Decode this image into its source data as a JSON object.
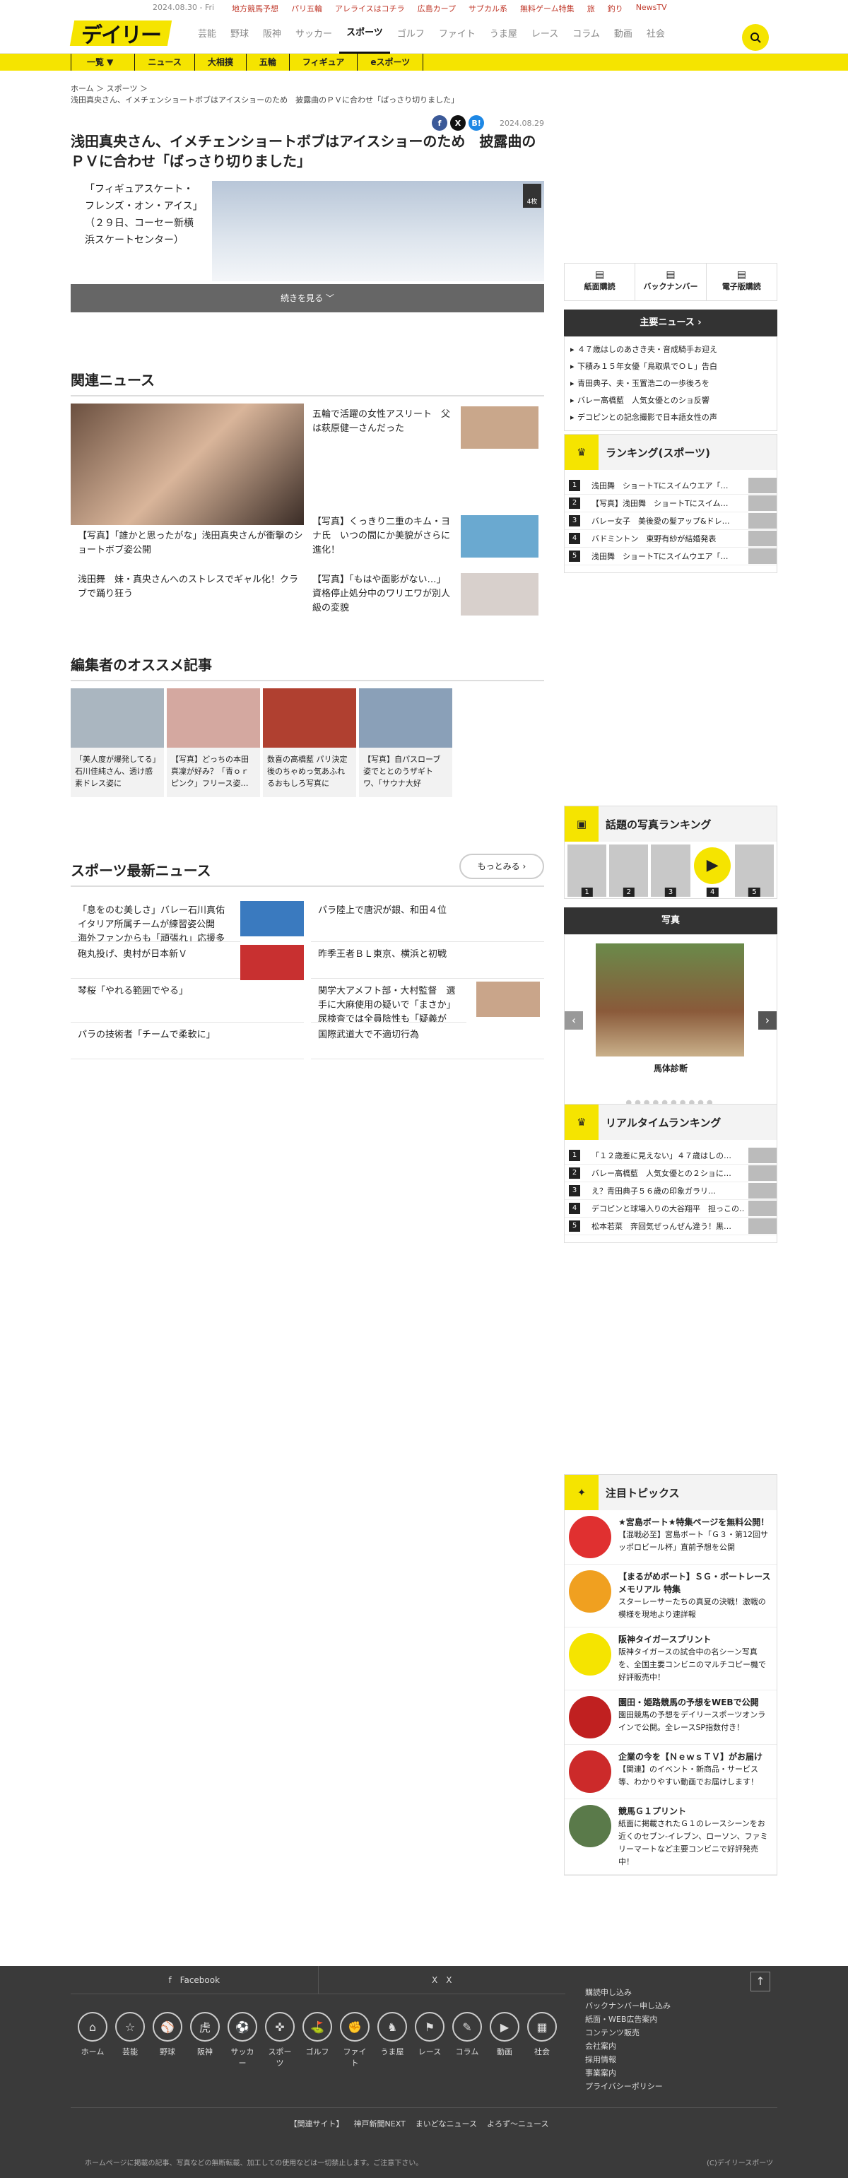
{
  "topbar": {
    "date": "2024.08.30 - Fri",
    "links": [
      "地方競馬予想",
      "パリ五輪",
      "アレライスはコチラ",
      "広島カープ",
      "サブカル系",
      "無料ゲーム特集",
      "旅",
      "釣り",
      "NewsTV"
    ]
  },
  "logo": "デイリー",
  "gnav": [
    "芸能",
    "野球",
    "阪神",
    "サッカー",
    "スポーツ",
    "ゴルフ",
    "ファイト",
    "うま屋",
    "レース",
    "コラム",
    "動画",
    "社会"
  ],
  "subnav": [
    "一覧 ▼",
    "ニュース",
    "大相撲",
    "五輪",
    "フィギュア",
    "eスポーツ"
  ],
  "breadcrumb": {
    "home": "ホーム",
    "cat": "スポーツ",
    "current": "浅田真央さん、イメチェンショートボブはアイスショーのため　披露曲のＰＶに合わせ「ばっさり切りました」"
  },
  "article": {
    "date": "2024.08.29",
    "title": "浅田真央さん、イメチェンショートボブはアイスショーのため　披露曲のＰＶに合わせ「ばっさり切りました」",
    "lead": "「フィギュアスケート・フレンズ・オン・アイス」（２９日、コーセー新横浜スケートセンター）",
    "photos": "4枚",
    "readmore": "続きを見る"
  },
  "related": {
    "heading": "関連ニュース",
    "items": [
      "【写真】「誰かと思ったがな」浅田真央さんが衝撃のショートボブ姿公開",
      "浅田舞　妹・真央さんへのストレスでギャル化！クラブで踊り狂う",
      "五輪で活躍の女性アスリート　父は萩原健一さんだった",
      "【写真】くっきり二重のキム・ヨナ氏　いつの間にか美貌がさらに進化！",
      "【写真】「もはや面影がない…」資格停止処分中のワリエワが別人級の変貌"
    ]
  },
  "recommend": {
    "heading": "編集者のオススメ記事",
    "items": [
      "「美人度が爆発してる」石川佳純さん、透け感素ドレス姿に",
      "【写真】どっちの本田真凜が好み？「青ｏｒピンク」フリース姿…",
      "数喜の高橋藍 パリ決定後のちゃめっ気あふれるおもしろ写真に",
      "【写真】自パスローブ姿でととのうザギトワ、「サウナ大好"
    ]
  },
  "latest": {
    "heading": "スポーツ最新ニュース",
    "more": "もっとみる",
    "items": [
      "「息をのむ美しさ」バレー石川真佑　イタリア所属チームが練習姿公開　海外ファンからも「頑張れ」応援多数",
      "パラ陸上で唐沢が銀、和田４位",
      "砲丸投げ、奥村が日本新Ｖ",
      "昨季王者ＢＬ東京、横浜と初戦",
      "琴桜「やれる範囲でやる」",
      "関学大アメフト部・大村監督　選手に大麻使用の疑いで「まさか」　尿検査では全員陰性も「疑義が我々の部員から出たのは残念。力不足」",
      "パラの技術者「チームで柔軟に」",
      "国際武道大で不適切行為"
    ]
  },
  "side_buttons": [
    "紙面購読",
    "バックナンバー",
    "電子版購読"
  ],
  "main_news": {
    "heading": "主要ニュース",
    "items": [
      "４７歳はしのあさき夫・音成騎手お迎え",
      "下積み１５年女優「鳥取県でＯＬ」告白",
      "青田典子、夫・玉置浩二の一歩後ろを",
      "バレー高橋藍　人気女優とのショ反響",
      "デコピンとの記念撮影で日本語女性の声"
    ]
  },
  "ranking_sports": {
    "heading": "ランキング(スポーツ)",
    "items": [
      "浅田舞　ショートTにスイムウエア「…",
      "【写真】浅田舞　ショートTにスイム…",
      "バレー女子　美後愛の髪アップ&ドレ…",
      "バドミントン　東野有紗が結婚発表",
      "浅田舞　ショートTにスイムウエア「…"
    ]
  },
  "photo_ranking": {
    "heading": "話題の写真ランキング",
    "nums": [
      "1",
      "2",
      "3",
      "4",
      "5"
    ]
  },
  "photo": {
    "heading": "写真",
    "caption": "馬体診断"
  },
  "realtime": {
    "heading": "リアルタイムランキング",
    "items": [
      "「１２歳差に見えない」４７歳はしの…",
      "バレー高橋藍　人気女優との２ショに…",
      "え？青田典子５６歳の印象ガラリ…",
      "デコピンと球場入りの大谷翔平　担っこの…",
      "松本若菜　奔回気ぜっんぜん違う！黒…"
    ]
  },
  "topics": {
    "heading": "注目トピックス",
    "items": [
      {
        "t": "★宮島ボート★特集ページを無料公開！",
        "d": "【混戦必至】宮島ボート「Ｇ３・第12回サッポロビール杯」直前予想を公開"
      },
      {
        "t": "【まるがめボート】ＳＧ・ボートレースメモリアル 特集",
        "d": "スターレーサーたちの真夏の決戦！激戦の模様を現地より速詳報"
      },
      {
        "t": "阪神タイガースプリント",
        "d": "阪神タイガースの試合中の名シーン写真を、全国主要コンビニのマルチコピー機で好評販売中！"
      },
      {
        "t": "園田・姫路競馬の予想をWEBで公開",
        "d": "園田競馬の予想をデイリースポーツオンラインで公開。全レースSP指数付き！"
      },
      {
        "t": "企業の今を【ＮｅｗｓＴＶ】がお届け",
        "d": "【関連】のイベント・新商品・サービス等、わかりやすい動画でお届けします！"
      },
      {
        "t": "競馬Ｇ１プリント",
        "d": "紙面に掲載されたＧ１のレースシーンをお近くのセブン-イレブン、ローソン、ファミリーマートなど主要コンビニで好評発売中！"
      }
    ]
  },
  "footer": {
    "facebook": "Facebook",
    "x": "X",
    "icons": [
      "ホーム",
      "芸能",
      "野球",
      "阪神",
      "サッカー",
      "スポーツ",
      "ゴルフ",
      "ファイト",
      "うま屋",
      "レース",
      "コラム",
      "動画",
      "社会"
    ],
    "links": [
      "購読申し込み",
      "バックナンバー申し込み",
      "紙面・WEB広告案内",
      "コンテンツ販売",
      "会社案内",
      "採用情報",
      "事業案内",
      "プライバシーポリシー"
    ],
    "related_label": "【関連サイト】",
    "related": [
      "神戸新聞NEXT",
      "まいどなニュース",
      "よろず〜ニュース"
    ],
    "copyright": "ホームページに掲載の記事、写真などの無断転載、加工しての使用などは一切禁止します。ご注意下さい。",
    "copy2": "(C)デイリースポーツ"
  }
}
